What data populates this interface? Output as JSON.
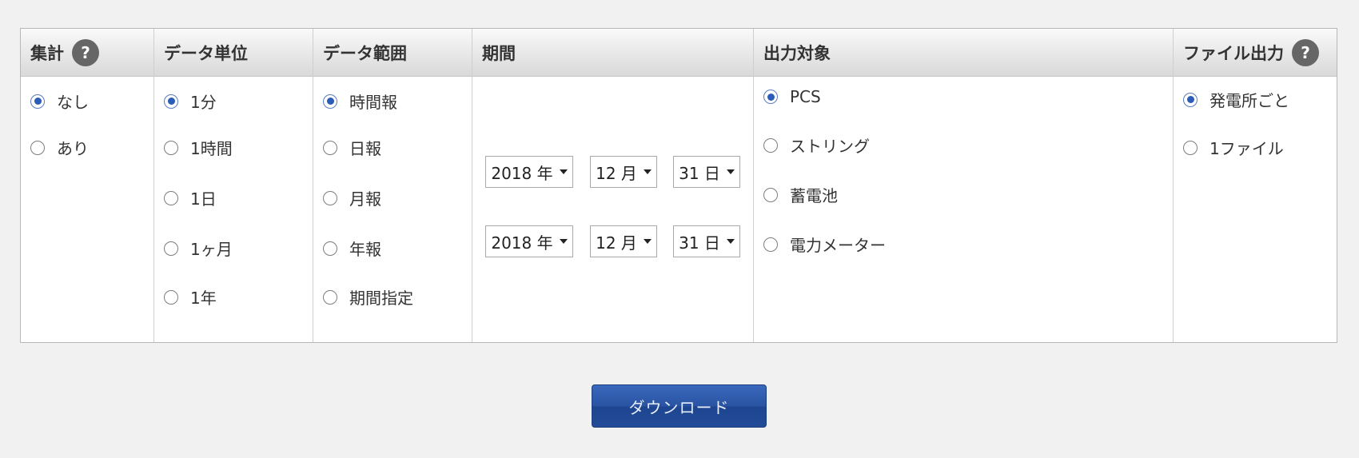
{
  "columns": {
    "aggregate": {
      "header": "集計",
      "help": "?",
      "options": [
        "なし",
        "あり"
      ],
      "selected": "なし"
    },
    "unit": {
      "header": "データ単位",
      "options": [
        "1分",
        "1時間",
        "1日",
        "1ヶ月",
        "1年"
      ],
      "selected": "1分"
    },
    "range": {
      "header": "データ範囲",
      "options": [
        "時間報",
        "日報",
        "月報",
        "年報",
        "期間指定"
      ],
      "selected": "時間報"
    },
    "period": {
      "header": "期間",
      "start": {
        "year": "2018 年",
        "month": "12 月",
        "day": "31 日"
      },
      "end": {
        "year": "2018 年",
        "month": "12 月",
        "day": "31 日"
      }
    },
    "target": {
      "header": "出力対象",
      "options": [
        "PCS",
        "ストリング",
        "蓄電池",
        "電力メーター"
      ],
      "selected": "PCS"
    },
    "file_output": {
      "header": "ファイル出力",
      "help": "?",
      "options": [
        "発電所ごと",
        "1ファイル"
      ],
      "selected": "発電所ごと"
    }
  },
  "download_label": "ダウンロード",
  "colors": {
    "accent": "#2b5cb8",
    "button": "#2a54a3"
  }
}
